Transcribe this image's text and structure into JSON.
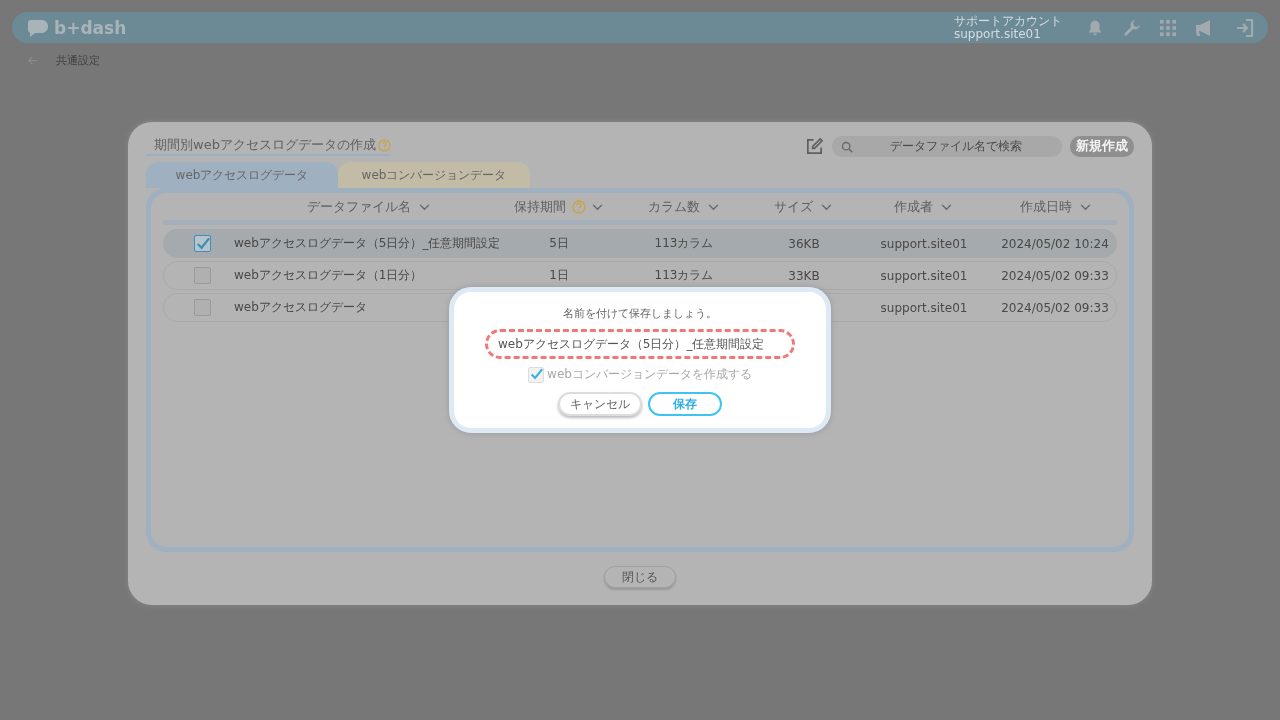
{
  "header": {
    "logo": "b+dash",
    "account_label": "サポートアカウント",
    "account_id": "support.site01"
  },
  "breadcrumb": {
    "label": "共通設定"
  },
  "modal": {
    "title": "期間別webアクセスログデータの作成",
    "search": {
      "placeholder": "データファイル名で検索"
    },
    "new_button": "新規作成",
    "tabs": [
      {
        "label": "webアクセスログデータ",
        "selected": true
      },
      {
        "label": "webコンバージョンデータ",
        "selected": false
      }
    ],
    "columns": [
      {
        "label": "データファイル名",
        "help": false
      },
      {
        "label": "保持期間",
        "help": true
      },
      {
        "label": "カラム数",
        "help": false
      },
      {
        "label": "サイズ",
        "help": false
      },
      {
        "label": "作成者",
        "help": false
      },
      {
        "label": "作成日時",
        "help": false
      }
    ],
    "rows": [
      {
        "checked": true,
        "selected": true,
        "cells": [
          "webアクセスログデータ（5日分）_任意期間設定",
          "5日",
          "113カラム",
          "36KB",
          "support.site01",
          "2024/05/02 10:24"
        ]
      },
      {
        "checked": false,
        "selected": false,
        "cells": [
          "webアクセスログデータ（1日分）",
          "1日",
          "113カラム",
          "33KB",
          "support.site01",
          "2024/05/02 09:33"
        ]
      },
      {
        "checked": false,
        "selected": false,
        "cells": [
          "webアクセスログデータ",
          "",
          "",
          "",
          "support.site01",
          "2024/05/02 09:33"
        ]
      }
    ],
    "close_button": "閉じる"
  },
  "dialog": {
    "prompt": "名前を付けて保存しましょう。",
    "name_value": "webアクセスログデータ（5日分）_任意期間設定",
    "create_conversion": {
      "label": "webコンバージョンデータを作成する",
      "checked": true,
      "disabled": true
    },
    "buttons": [
      {
        "label": "キャンセル",
        "kind": "secondary"
      },
      {
        "label": "保存",
        "kind": "primary"
      }
    ]
  }
}
